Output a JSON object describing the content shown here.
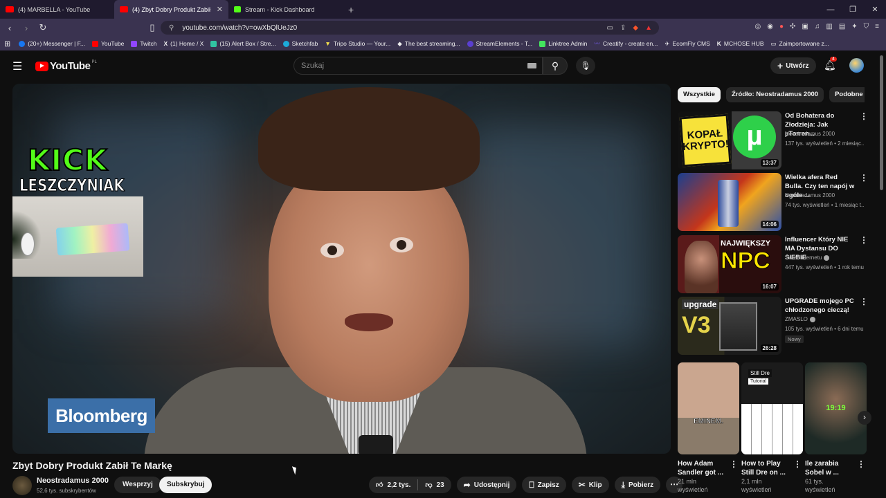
{
  "browser": {
    "tabs": [
      {
        "title": "(4) MARBELLA - YouTube",
        "icon": "youtube-favicon",
        "color": "#ff0000"
      },
      {
        "title": "(4) Zbyt Dobry Produkt Zabił",
        "icon": "youtube-favicon",
        "color": "#ff0000"
      },
      {
        "title": "Stream - Kick Dashboard",
        "icon": "kick-favicon",
        "color": "#53fc18"
      }
    ],
    "new_tab": "+",
    "url": "youtube.com/watch?v=owXbQlUeJz0",
    "bookmarks": [
      {
        "label": "(20+) Messenger | F...",
        "color": "#1877f2"
      },
      {
        "label": "YouTube",
        "color": "#ff0000"
      },
      {
        "label": "Twitch",
        "color": "#9146ff"
      },
      {
        "label": "(1) Home / X",
        "color": "#ffffff"
      },
      {
        "label": "(15) Alert Box / Stre...",
        "color": "#31c3a2"
      },
      {
        "label": "Sketchfab",
        "color": "#1caad9"
      },
      {
        "label": "Tripo Studio — Your...",
        "color": "#f4e04d"
      },
      {
        "label": "The best streaming...",
        "color": "#ffffff"
      },
      {
        "label": "StreamElements - T...",
        "color": "#5a3fd1"
      },
      {
        "label": "Linktree Admin",
        "color": "#43e55e"
      },
      {
        "label": "Creatify - create en...",
        "color": "#7b61ff"
      },
      {
        "label": "EcomFly CMS",
        "color": "#ffffff"
      },
      {
        "label": "MCHOSE HUB",
        "color": "#ffffff"
      },
      {
        "label": "Zaimportowane z...",
        "color": "#cccccc"
      }
    ]
  },
  "youtube": {
    "logo_text": "YouTube",
    "region": "PL",
    "search_placeholder": "Szukaj",
    "create_label": "Utwórz",
    "notifications_count": "4",
    "video": {
      "overlay_kick": "KICK",
      "overlay_name": "LESZCZYNIAK",
      "watermark": "Bloomberg",
      "title": "Zbyt Dobry Produkt Zabił Te Markę",
      "channel": "Neostradamus 2000",
      "subscribers": "52,6 tys. subskrybentów",
      "support_label": "Wesprzyj",
      "subscribe_label": "Subskrybuj",
      "likes": "2,2 tys.",
      "dislikes": "23",
      "share_label": "Udostępnij",
      "save_label": "Zapisz",
      "clip_label": "Klip",
      "download_label": "Pobierz"
    },
    "chips": [
      "Wszystkie",
      "Źródło: Neostradamus 2000",
      "Podobne"
    ],
    "recommendations": [
      {
        "title": "Od Bohatera do Złodzieja: Jak µTorren...",
        "channel": "Neostradamus 2000",
        "meta": "137 tys. wyświetleń • 2 miesiąc...",
        "duration": "13:37",
        "verified": false,
        "new": ""
      },
      {
        "title": "Wielka afera Red Bulla. Czy ten napój w ogóle ...",
        "channel": "Neostradamus 2000",
        "meta": "74 tys. wyświetleń • 1 miesiąc t...",
        "duration": "14:06",
        "verified": false,
        "new": ""
      },
      {
        "title": "Influencer Który NIE MA Dystansu DO SIEBIE",
        "channel": "Świat Internetu",
        "meta": "447 tys. wyświetleń • 1 rok temu",
        "duration": "16:07",
        "verified": true,
        "new": ""
      },
      {
        "title": "UPGRADE mojego PC chłodzonego cieczą!",
        "channel": "ZMASLO",
        "meta": "105 tys. wyświetleń • 6 dni temu",
        "duration": "26:28",
        "verified": true,
        "new": "Nowy"
      }
    ],
    "thumb_texts": {
      "t1": "KOPAŁ KRYPTO!",
      "t3a": "NAJWIĘKSZY",
      "t3b": "NPC",
      "t4": "upgrade",
      "t4b": "V3"
    },
    "shorts": [
      {
        "title": "How Adam Sandler got ...",
        "views": "21 mln",
        "views2": "wyświetleń",
        "overlay": "EMINEM."
      },
      {
        "title": "How to Play Still Dre on ...",
        "views": "2,1 mln",
        "views2": "wyświetleń",
        "overlay": "Still Dre",
        "overlay2": "Tutorial"
      },
      {
        "title": "Ile zarabia Sobel w ...",
        "views": "61 tys.",
        "views2": "wyświetleń",
        "overlay": "19:19"
      }
    ]
  }
}
